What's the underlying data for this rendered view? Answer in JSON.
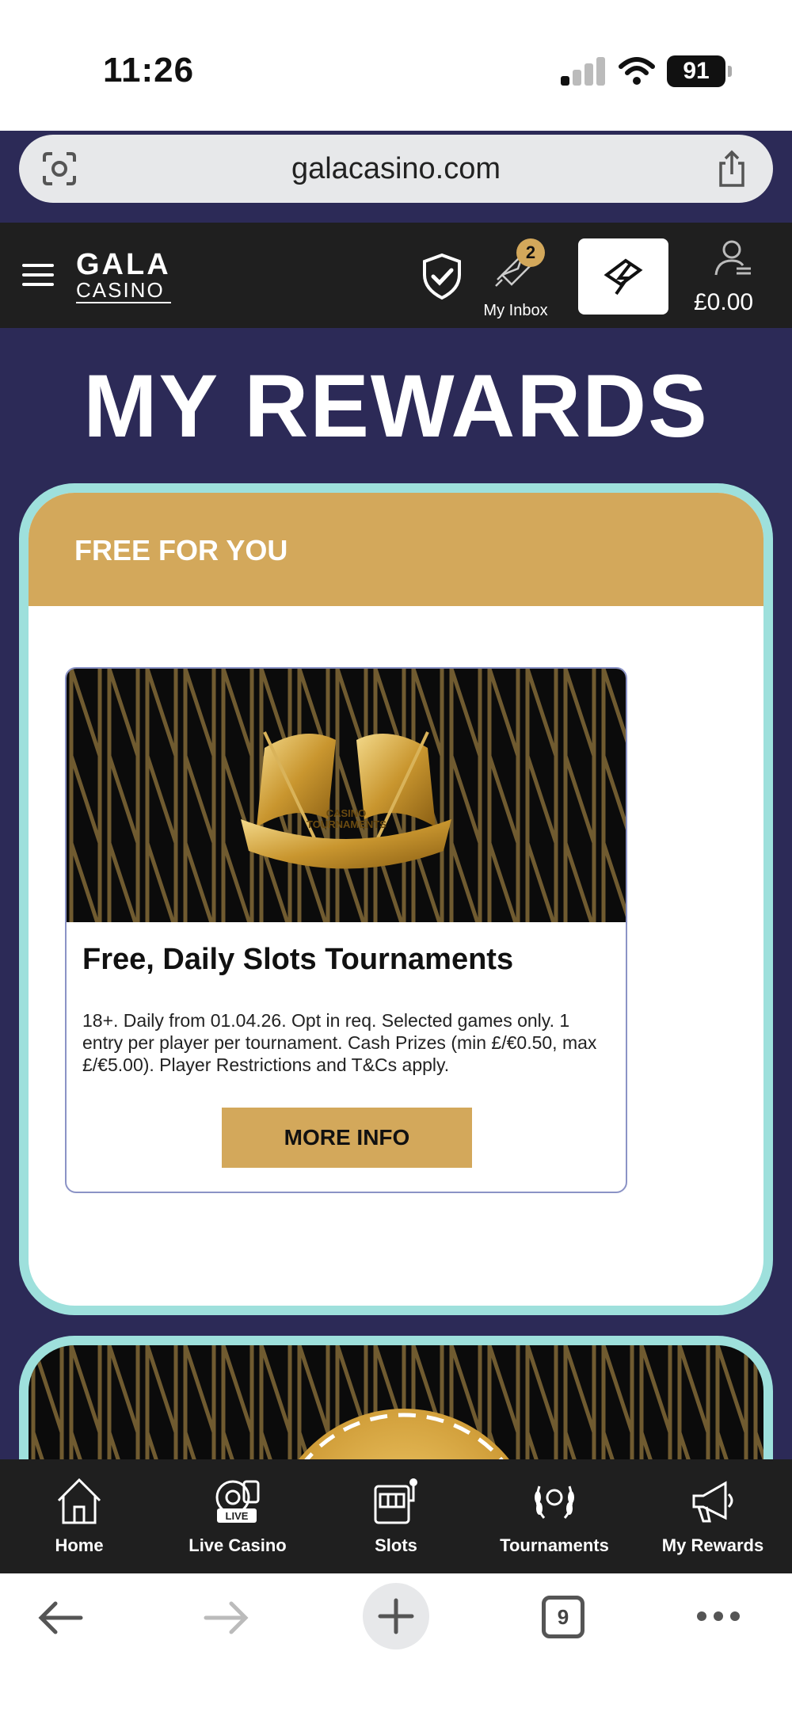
{
  "status_bar": {
    "time": "11:26",
    "battery": "91"
  },
  "browser": {
    "url": "galacasino.com",
    "tab_count": "9"
  },
  "header": {
    "logo_line1": "GALA",
    "logo_line2": "CASINO",
    "inbox_badge": "2",
    "inbox_label": "My Inbox",
    "balance": "£0.00"
  },
  "page": {
    "title": "MY REWARDS"
  },
  "section": {
    "heading": "FREE FOR YOU"
  },
  "promo": {
    "image_text": "CASINO TOURNAMENTS",
    "title": "Free, Daily Slots Tournaments",
    "terms": "18+. Daily from 01.04.26. Opt in req. Selected games only. 1 entry per player per tournament. Cash Prizes (min £/€0.50, max £/€5.00). Player Restrictions and T&Cs apply.",
    "button": "MORE INFO"
  },
  "bottom_nav": [
    {
      "label": "Home",
      "icon": "home-icon"
    },
    {
      "label": "Live Casino",
      "icon": "live-casino-icon"
    },
    {
      "label": "Slots",
      "icon": "slot-machine-icon"
    },
    {
      "label": "Tournaments",
      "icon": "laurel-icon"
    },
    {
      "label": "My Rewards",
      "icon": "megaphone-icon"
    }
  ],
  "colors": {
    "gold": "#d3a85b",
    "navy": "#2c2a57",
    "teal_border": "#9ee0dc",
    "header_bg": "#1f1f1f"
  }
}
